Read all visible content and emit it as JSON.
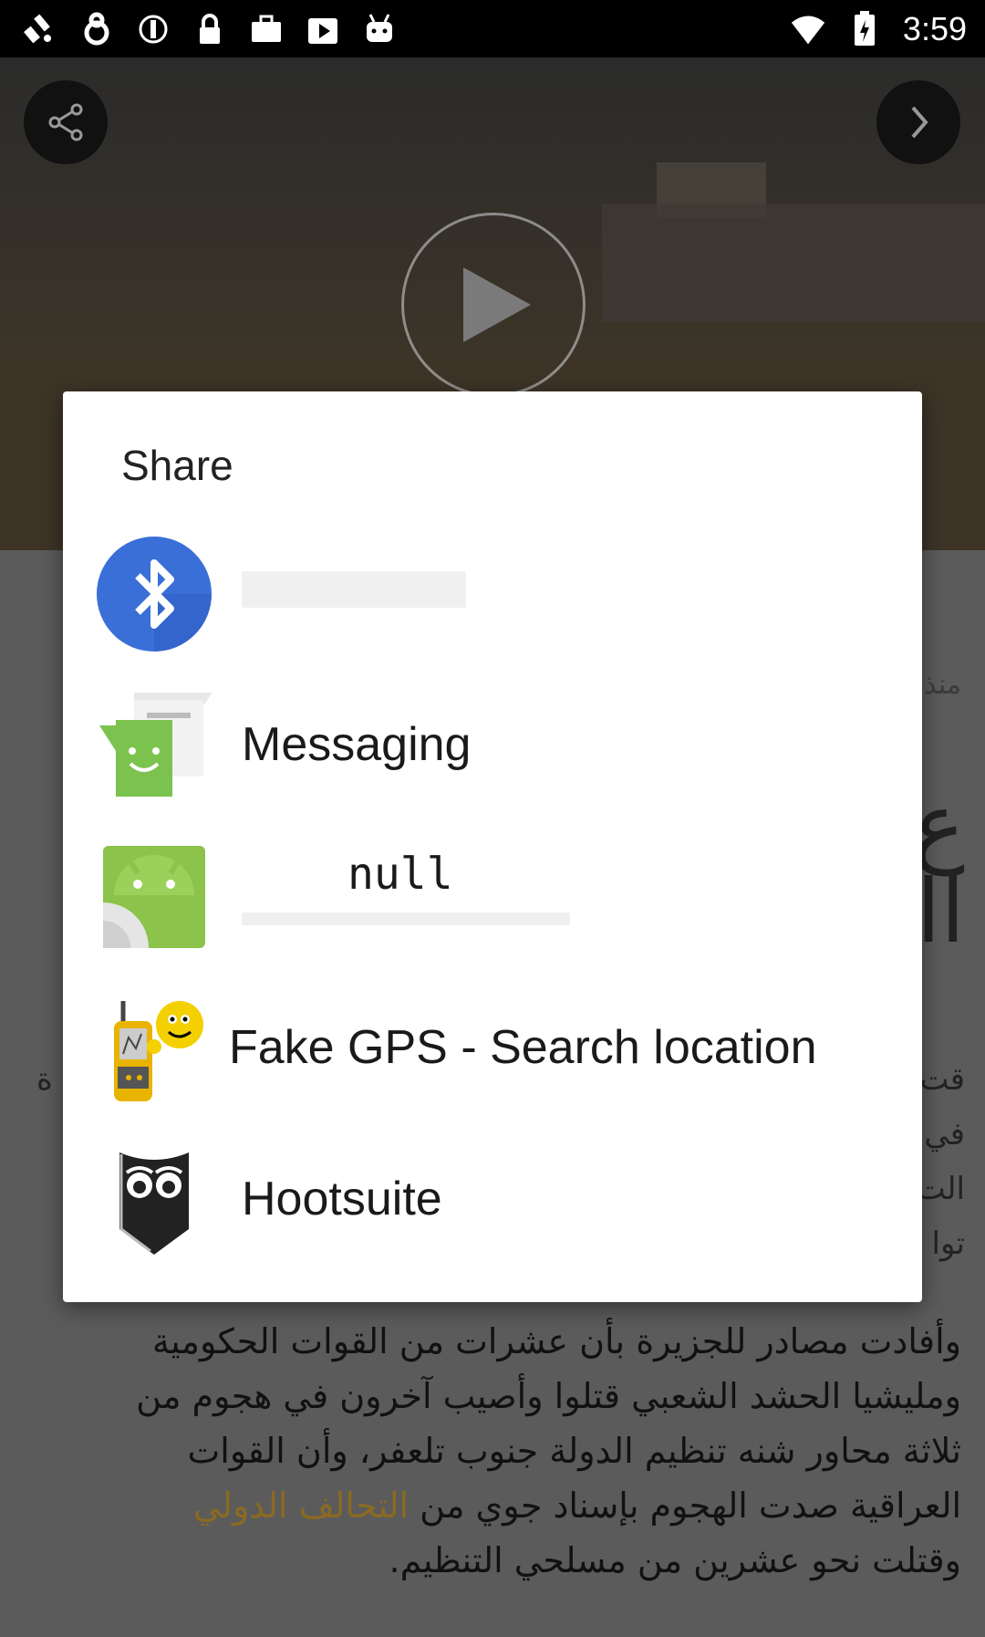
{
  "status_bar": {
    "time": "3:59",
    "left_icons": [
      "fake-gps-icon",
      "alarm-icon",
      "sync-icon",
      "lock-icon",
      "briefcase-icon",
      "play-store-icon",
      "android-icon"
    ],
    "right_icons": [
      "wifi-icon",
      "battery-charging-icon"
    ]
  },
  "background": {
    "video_buttons": [
      "share-icon",
      "next-icon",
      "play-icon"
    ],
    "meta_text": "منذ",
    "article_lines": [
      "وأفادت مصادر للجزيرة بأن عشرات من القوات الحكومية",
      "ومليشيا الحشد الشعبي قتلوا وأصيب آخرون في هجوم من",
      "ثلاثة محاور شنه تنظيم الدولة جنوب تلعفر، وأن القوات",
      "العراقية صدت الهجوم بإسناد جوي من",
      "وقتلت نحو عشرين من مسلحي التنظيم."
    ],
    "article_link": "التحالف الدولي",
    "side_fragments_right": [
      "قت",
      "في",
      "الت",
      "توا"
    ],
    "side_fragments_left": [
      "ة",
      "ة"
    ]
  },
  "dialog": {
    "title": "Share",
    "apps": [
      {
        "label": "",
        "icon": "bluetooth-icon"
      },
      {
        "label": "Messaging",
        "icon": "messaging-icon"
      },
      {
        "label": "null",
        "icon": "android-app-icon"
      },
      {
        "label": "Fake GPS - Search location",
        "icon": "fake-gps-app-icon"
      },
      {
        "label": "Hootsuite",
        "icon": "hootsuite-owl-icon"
      }
    ]
  },
  "colors": {
    "bluetooth_blue": "#3a6fd8",
    "messaging_green": "#7cc24e",
    "android_green": "#8cc34a",
    "dialog_bg": "#ffffff",
    "scrim": "#5a5a5a",
    "link_gold": "#8a6a22"
  }
}
